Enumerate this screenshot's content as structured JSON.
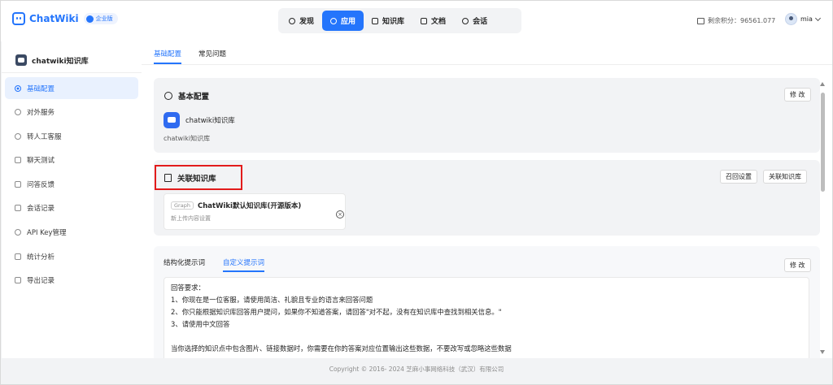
{
  "header": {
    "logo_text": "ChatWiki",
    "edition_badge": "企业版",
    "nav": [
      {
        "label": "发现",
        "icon": "compass-icon",
        "active": false
      },
      {
        "label": "应用",
        "icon": "app-icon",
        "active": true
      },
      {
        "label": "知识库",
        "icon": "book-icon",
        "active": false
      },
      {
        "label": "文档",
        "icon": "doc-icon",
        "active": false
      },
      {
        "label": "会话",
        "icon": "chat-icon",
        "active": false
      }
    ],
    "credits_label": "剩余积分：",
    "credits_value": "96561.077",
    "username": "mia"
  },
  "sidebar": {
    "app_name": "chatwiki知识库",
    "items": [
      {
        "label": "基础配置",
        "icon": "settings-icon",
        "active": true
      },
      {
        "label": "对外服务",
        "icon": "share-icon",
        "active": false
      },
      {
        "label": "转人工客服",
        "icon": "headset-icon",
        "active": false
      },
      {
        "label": "聊天测试",
        "icon": "chat-test-icon",
        "active": false
      },
      {
        "label": "问答反馈",
        "icon": "feedback-icon",
        "active": false
      },
      {
        "label": "会话记录",
        "icon": "record-icon",
        "active": false
      },
      {
        "label": "API Key管理",
        "icon": "key-icon",
        "active": false
      },
      {
        "label": "统计分析",
        "icon": "stats-icon",
        "active": false
      },
      {
        "label": "导出记录",
        "icon": "export-icon",
        "active": false
      }
    ]
  },
  "tabs": [
    "基础配置",
    "常见问题"
  ],
  "basic": {
    "title": "基本配置",
    "edit_label": "修 改",
    "app_name": "chatwiki知识库",
    "app_desc": "chatwiki知识库"
  },
  "kb": {
    "title": "关联知识库",
    "recall_btn": "召回设置",
    "link_btn": "关联知识库",
    "card_badge": "Graph",
    "card_name": "ChatWiki默认知识库(开源版本)",
    "card_sub": "新上传内容设置"
  },
  "prompt": {
    "tabs": [
      "结构化提示词",
      "自定义提示词"
    ],
    "edit_label": "修 改",
    "lines": [
      "回答要求：",
      "1、你现在是一位客服，请使用简洁、礼貌且专业的语言来回答问题",
      "2、你只能根据知识库回答用户提问，如果你不知道答案，请回答\"对不起，没有在知识库中查找到相关信息。\"",
      "3、请使用中文回答",
      "",
      "当你选择的知识点中包含图片、链接数据时，你需要在你的答案对应位置输出这些数据，不要改写或忽略这些数据"
    ]
  },
  "footer": "Copyright © 2016- 2024 芝麻小事网络科技（武汉）有限公司",
  "colors": {
    "accent": "#2475fc",
    "highlight": "#e21b1b"
  }
}
